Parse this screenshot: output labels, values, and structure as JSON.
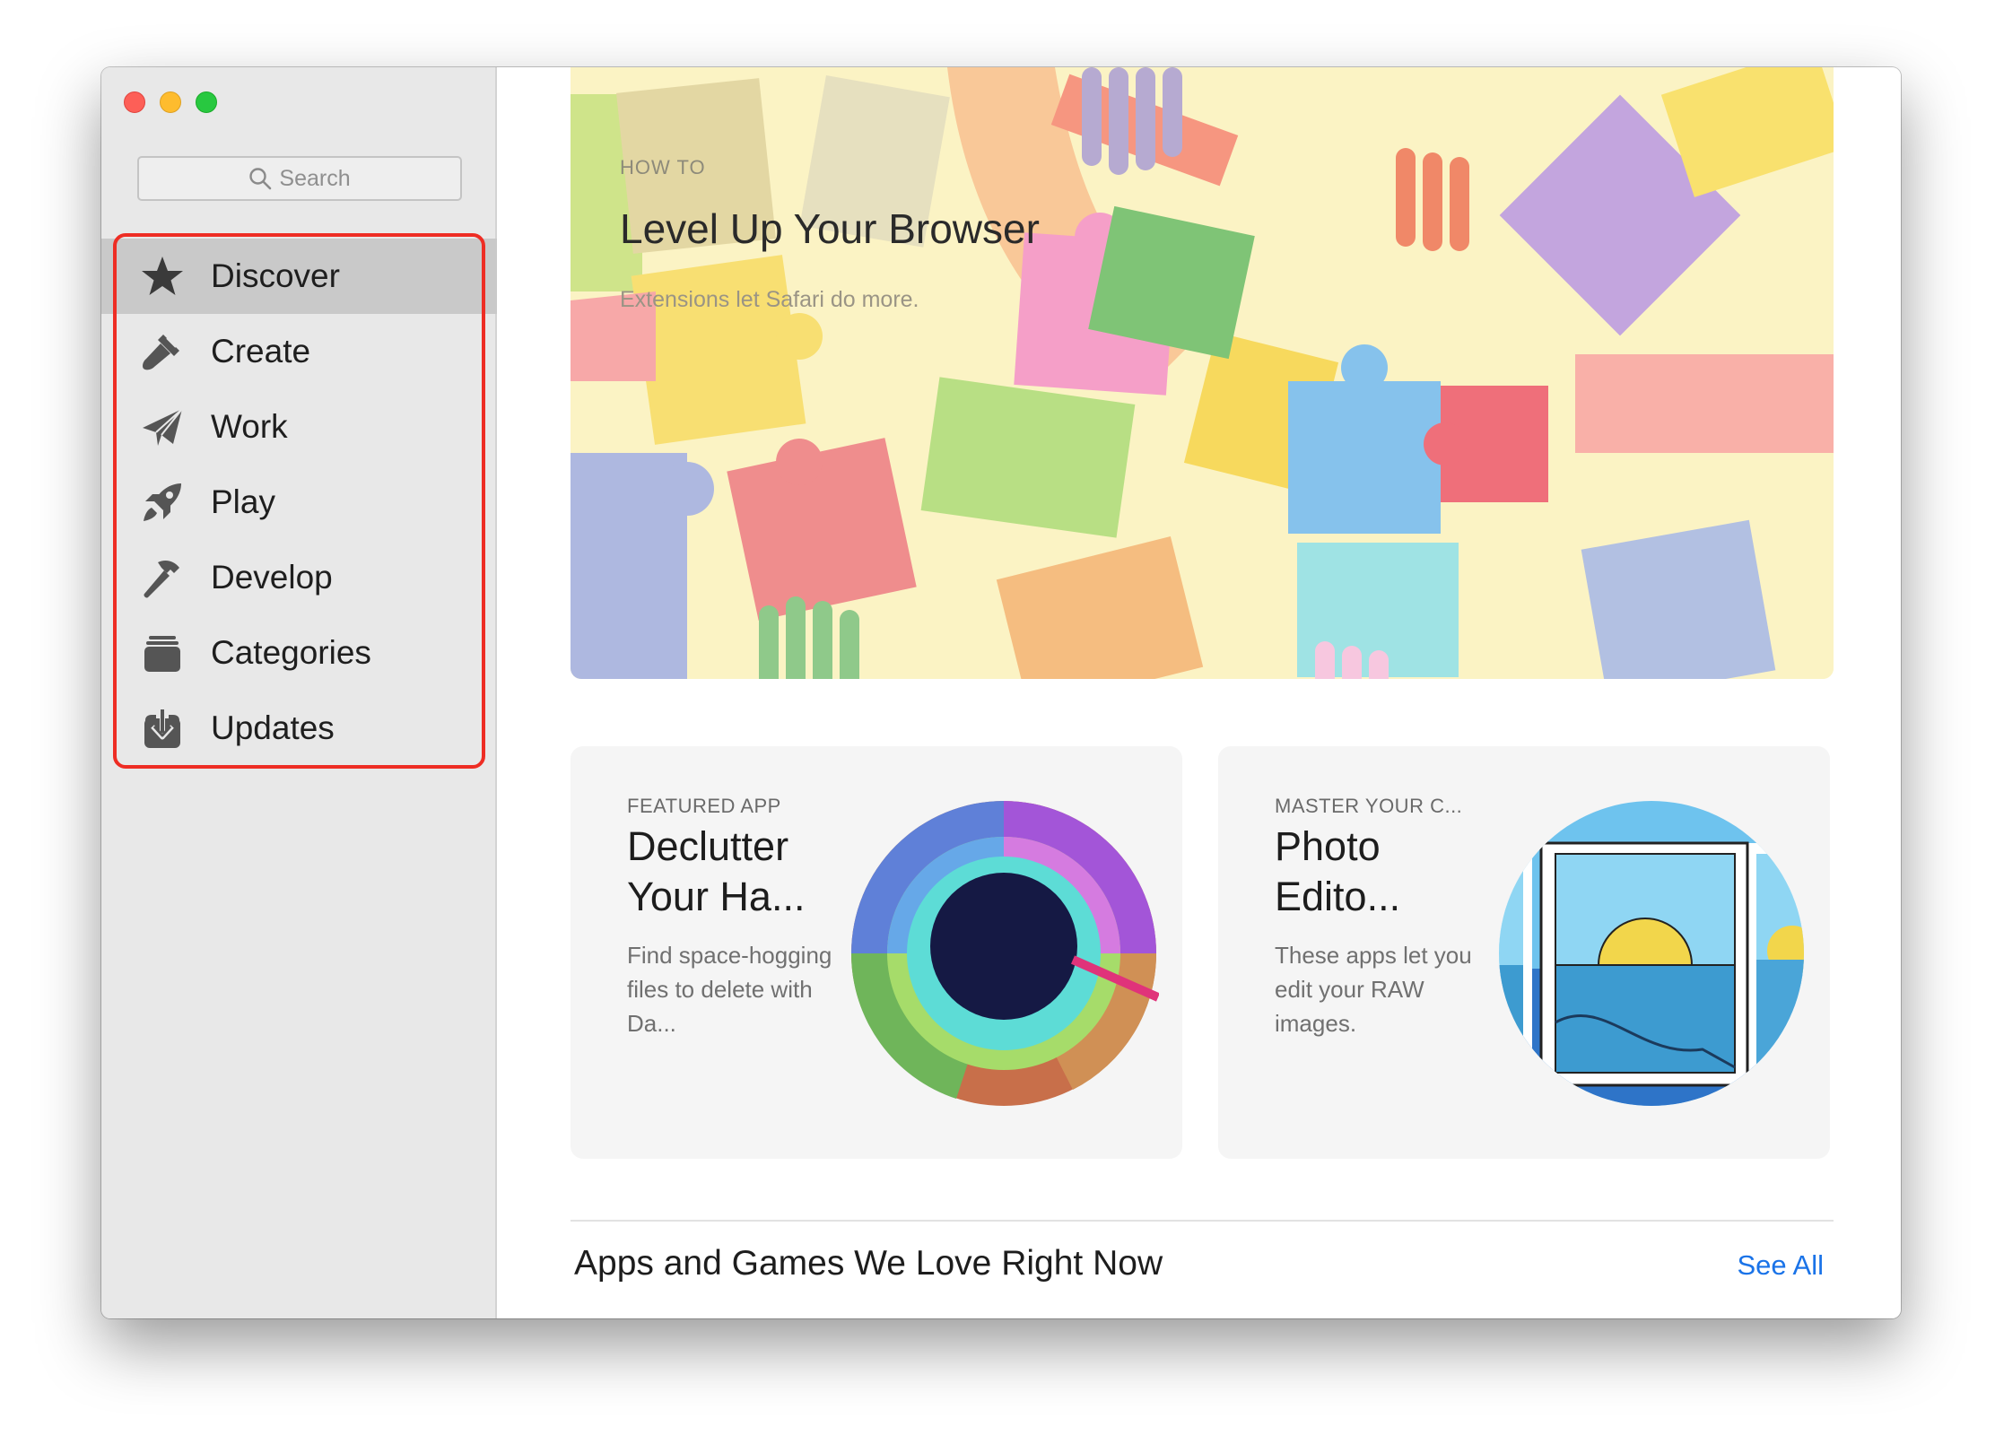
{
  "window": {
    "controls": [
      "close",
      "minimize",
      "zoom"
    ]
  },
  "sidebar": {
    "search": {
      "placeholder": "Search"
    },
    "items": [
      {
        "label": "Discover",
        "icon": "star-icon",
        "active": true
      },
      {
        "label": "Create",
        "icon": "brush-icon"
      },
      {
        "label": "Work",
        "icon": "paper-plane-icon"
      },
      {
        "label": "Play",
        "icon": "rocket-icon"
      },
      {
        "label": "Develop",
        "icon": "hammer-icon"
      },
      {
        "label": "Categories",
        "icon": "categories-icon"
      },
      {
        "label": "Updates",
        "icon": "download-icon"
      }
    ]
  },
  "hero": {
    "eyebrow": "HOW TO",
    "title": "Level Up Your Browser",
    "subtitle": "Extensions let Safari do more."
  },
  "cards": [
    {
      "eyebrow": "FEATURED APP",
      "title": "Declutter Your Ha...",
      "description": "Find space-hogging files to delete with Da..."
    },
    {
      "eyebrow": "MASTER YOUR C...",
      "title": "Photo Edito...",
      "description": "These apps let you edit your RAW images."
    }
  ],
  "section": {
    "title": "Apps and Games We Love Right Now",
    "see_all": "See All"
  },
  "colors": {
    "accent": "#1a73e8",
    "annotation": "#ee2d24",
    "sidebar_bg": "#e8e8e8",
    "sidebar_active": "#c9c9c9",
    "hero_bg": "#fbf3c4"
  }
}
